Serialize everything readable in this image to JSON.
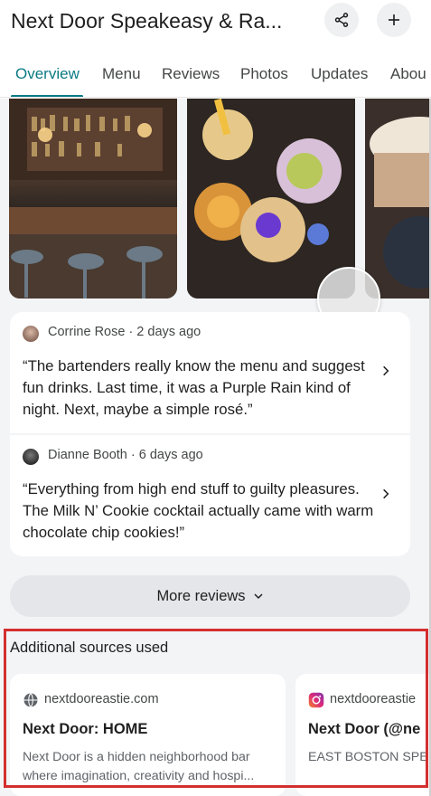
{
  "header": {
    "title": "Next Door Speakeasy & Ra...",
    "share_icon": "share-icon",
    "add_icon": "plus-icon"
  },
  "tabs": [
    {
      "label": "Overview",
      "active": true
    },
    {
      "label": "Menu"
    },
    {
      "label": "Reviews"
    },
    {
      "label": "Photos"
    },
    {
      "label": "Updates"
    },
    {
      "label": "Abou"
    }
  ],
  "reviews": [
    {
      "author": "Corrine Rose · 2 days ago",
      "text": "“The bartenders really know the menu and suggest fun drinks. Last time, it was a Purple Rain kind of night. Next, maybe a simple rosé.”"
    },
    {
      "author": "Dianne Booth · 6 days ago",
      "text": "“Everything from high end stuff to guilty pleasures. The Milk N’ Cookie cocktail actually came with warm chocolate chip cookies!”"
    }
  ],
  "more_reviews_label": "More reviews",
  "sources": {
    "title": "Additional sources used",
    "items": [
      {
        "host": "nextdooreastie.com",
        "title": "Next Door: HOME",
        "description": "Next Door is a hidden neighborhood bar where imagination, creativity and hospi..."
      },
      {
        "host": "nextdooreastie",
        "title": "Next Door (@ne",
        "description": "EAST BOSTON SPE looking for a spot w"
      }
    ]
  },
  "colors": {
    "accent": "#0b7a83",
    "highlight": "#d32f2f"
  }
}
